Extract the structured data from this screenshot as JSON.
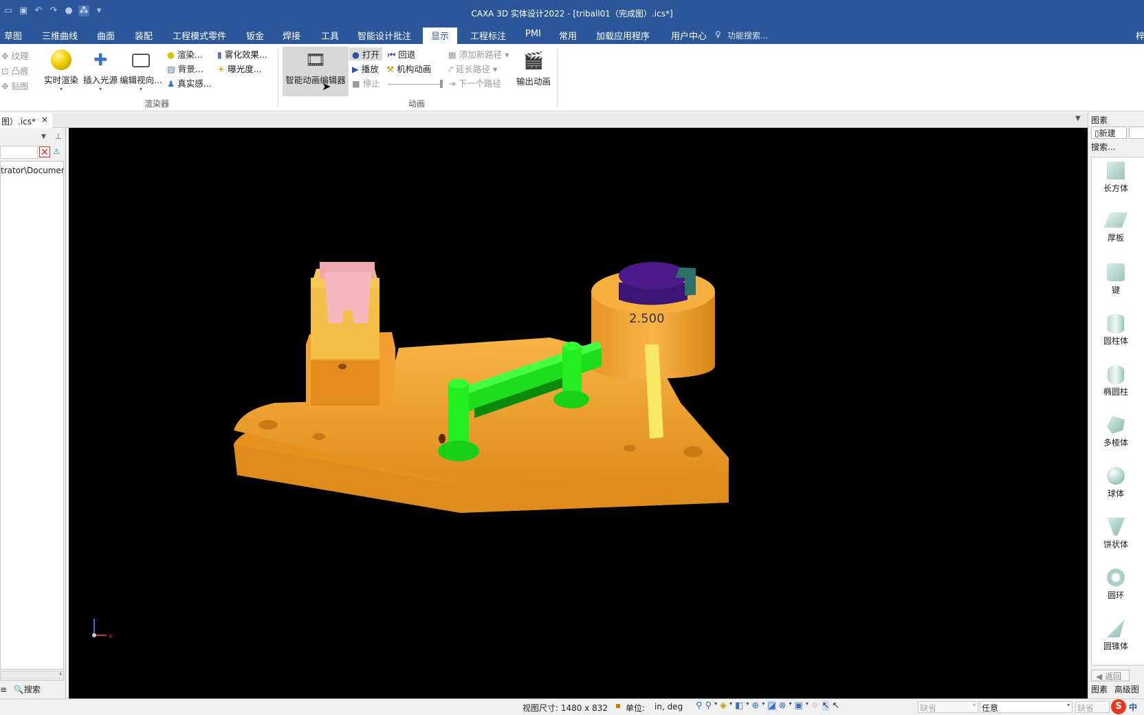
{
  "app": {
    "title": "CAXA 3D 实体设计2022 - [triball01（完成图）.ics*]"
  },
  "menu": {
    "tabs": [
      "草图",
      "三维曲线",
      "曲面",
      "装配",
      "工程模式零件",
      "钣金",
      "焊接",
      "工具",
      "智能设计批注",
      "显示",
      "工程标注",
      "PMI",
      "常用",
      "加载应用程序",
      "用户中心"
    ],
    "active": "显示",
    "search": "功能搜索...",
    "right_cut": "梓"
  },
  "ribbon": {
    "left_col": [
      "纹理",
      "凸痕",
      "贴图"
    ],
    "renderer": {
      "realtime": "实时渲染",
      "insert_light": "插入光源",
      "edit_view": "编辑视向...",
      "render": "渲染...",
      "background": "背景...",
      "realism": "真实感...",
      "fog": "雾化效果...",
      "exposure": "曝光度...",
      "group": "渲染器"
    },
    "animation": {
      "smart_editor": "智能动画编辑器",
      "open": "打开",
      "play": "播放",
      "stop": "停止",
      "rewind": "回退",
      "mech": "机构动画",
      "add_path": "添加新路径",
      "extend_path": "延长路径",
      "next_path": "下一个路径",
      "export": "输出动画",
      "group": "动画"
    }
  },
  "doc_tab": {
    "label": "图）.ics*",
    "close": "×"
  },
  "left_panel": {
    "path": "trator\\Documen",
    "search": "搜索"
  },
  "viewport": {
    "label_value": "2.500",
    "axis_x": "x"
  },
  "right_panel": {
    "title": "图素",
    "new": "新建",
    "search": "搜索...",
    "shapes": [
      "长方体",
      "厚板",
      "键",
      "圆柱体",
      "椭圆柱",
      "多棱体",
      "球体",
      "饼状体",
      "圆环",
      "圆锥体"
    ],
    "back": "返回",
    "tabs": [
      "图素",
      "高级图"
    ]
  },
  "status": {
    "view_size": "视图尺寸: 1480 x  832",
    "unit_label": "单位:",
    "unit_value": "in, deg",
    "default1": "缺省",
    "any": "任意",
    "default2": "缺省",
    "ime": "中"
  },
  "colors": {
    "accent": "#2b579a",
    "part_orange": "#f2a030",
    "green": "#22ee22",
    "purple": "#4a1a8a",
    "pink": "#f0a8b0"
  }
}
